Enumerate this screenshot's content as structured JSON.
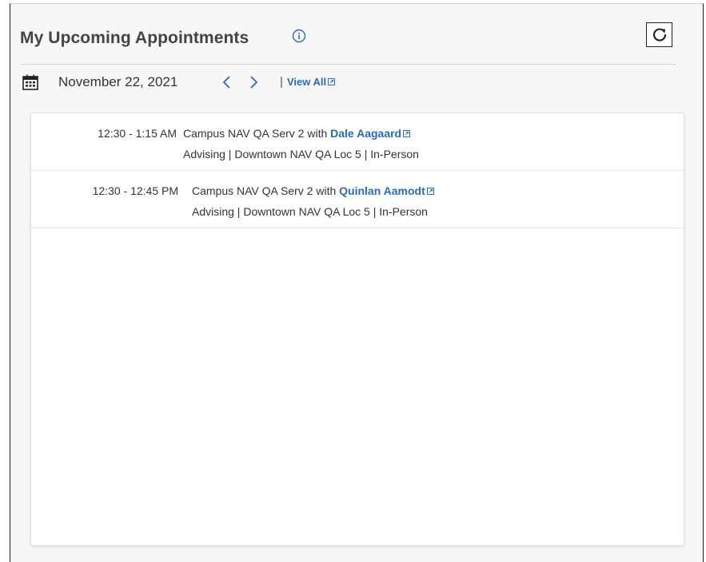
{
  "header": {
    "title": "My Upcoming Appointments",
    "info_icon": "info-circle-icon",
    "refresh_icon": "refresh-icon"
  },
  "date_nav": {
    "calendar_icon": "calendar-icon",
    "date": "November 22, 2021",
    "prev_icon": "chevron-left-icon",
    "next_icon": "chevron-right-icon",
    "separator": "|",
    "view_all_label": "View All",
    "view_all_icon": "external-link-icon"
  },
  "appointments": [
    {
      "time": "12:30 - 1:15 AM",
      "service": "Campus NAV QA Serv 2 with ",
      "person": "Dale Aagaard",
      "details": "Advising | Downtown NAV QA Loc 5 | In-Person"
    },
    {
      "time": "12:30 - 12:45 PM",
      "service": "Campus NAV QA Serv 2 with ",
      "person": "Quinlan Aamodt",
      "details": "Advising | Downtown NAV QA Loc 5 | In-Person"
    }
  ],
  "colors": {
    "link": "#2a6ab8",
    "title": "#444444",
    "panel_bg": "#f7f7f7"
  }
}
